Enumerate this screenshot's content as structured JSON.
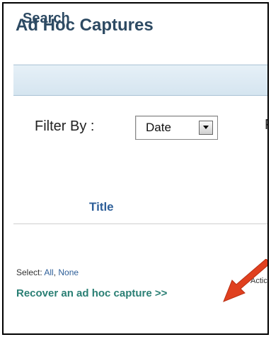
{
  "page": {
    "title": "Ad Hoc Captures"
  },
  "search": {
    "title": "Search"
  },
  "filter": {
    "label": "Filter By :",
    "selected": "Date",
    "truncated_label": "F"
  },
  "table": {
    "column_title": "Title"
  },
  "selection": {
    "prefix": "Select:",
    "all_label": "All",
    "separator": ",",
    "none_label": "None"
  },
  "actions": {
    "truncated_label": "Actic"
  },
  "recover_link": {
    "label": "Recover an ad hoc capture >>"
  },
  "colors": {
    "title": "#2d4a63",
    "link": "#2e5f99",
    "recover_link": "#2a7f74",
    "annotation_arrow": "#e0401f"
  },
  "icons": {
    "dropdown": "chevron-down-icon",
    "annotation": "red-arrow-icon"
  }
}
